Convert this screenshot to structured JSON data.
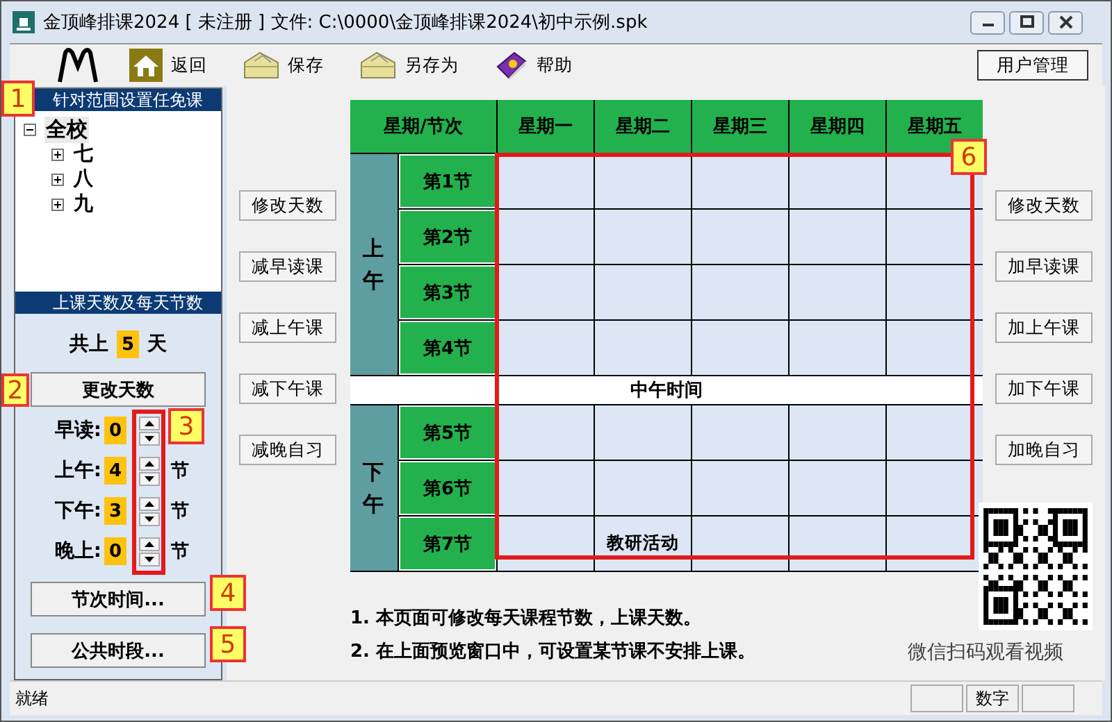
{
  "window": {
    "title": "金顶峰排课2024 [ 未注册 ] 文件: C:\\0000\\金顶峰排课2024\\初中示例.spk"
  },
  "toolbar": {
    "items": [
      {
        "kind": "home",
        "label": "返回"
      },
      {
        "kind": "folder",
        "label": "保存"
      },
      {
        "kind": "folder",
        "label": "另存为"
      },
      {
        "kind": "help",
        "label": "帮助"
      }
    ],
    "user_button": "用户管理"
  },
  "left_panel": {
    "scope_title": "针对范围设置任免课",
    "tree": {
      "label": "全校",
      "expanded": true,
      "selected": true,
      "children": [
        {
          "label": "七",
          "expanded": false,
          "selected": false
        },
        {
          "label": "八",
          "expanded": false,
          "selected": false
        },
        {
          "label": "九",
          "expanded": false,
          "selected": false
        }
      ]
    },
    "days_title": "上课天数及每天节数",
    "days": {
      "prefix": "共上",
      "value": "5",
      "suffix": "天"
    },
    "change_days_button": "更改天数",
    "periods": [
      {
        "label": "早读:",
        "value": "0"
      },
      {
        "label": "上午:",
        "value": "4",
        "unit": "节"
      },
      {
        "label": "下午:",
        "value": "3",
        "unit": "节"
      },
      {
        "label": "晚上:",
        "value": "0",
        "unit": "节"
      }
    ],
    "buttons": [
      "节次时间...",
      "公共时段..."
    ]
  },
  "left_buttons": [
    "修改天数",
    "减早读课",
    "减上午课",
    "减下午课",
    "减晚自习"
  ],
  "right_buttons": [
    "修改天数",
    "加早读课",
    "加上午课",
    "加下午课",
    "加晚自习"
  ],
  "timetable": {
    "corner": "星期/节次",
    "days": [
      "星期一",
      "星期二",
      "星期三",
      "星期四",
      "星期五"
    ],
    "sessions": [
      {
        "label": "上午",
        "periods": [
          {
            "label": "第1节",
            "cells": [
              {},
              {},
              {},
              {},
              {}
            ]
          },
          {
            "label": "第2节",
            "cells": [
              {},
              {},
              {},
              {},
              {}
            ]
          },
          {
            "label": "第3节",
            "cells": [
              {},
              {},
              {},
              {},
              {}
            ]
          },
          {
            "label": "第4节",
            "cells": [
              {},
              {},
              {},
              {},
              {}
            ]
          }
        ]
      },
      {
        "label": "下午",
        "periods": [
          {
            "label": "第5节",
            "cells": [
              {},
              {},
              {},
              {},
              {}
            ]
          },
          {
            "label": "第6节",
            "cells": [
              {},
              {},
              {},
              {},
              {}
            ]
          },
          {
            "label": "第7节",
            "cells": [
              {},
              {
                "text": "教研活动"
              },
              {},
              {},
              {}
            ]
          }
        ]
      }
    ],
    "break": "中午时间"
  },
  "notes": [
    "1. 本页面可修改每天课程节数，上课天数。",
    "2. 在上面预览窗口中，可设置某节课不安排上课。"
  ],
  "qr_caption": "微信扫码观看视频",
  "callouts": [
    "1",
    "2",
    "3",
    "4",
    "5",
    "6"
  ],
  "status_bar": {
    "text": "就绪",
    "panels": [
      {
        "kind": "blank"
      },
      {
        "kind": "label",
        "label": "数字"
      },
      {
        "kind": "blank"
      }
    ]
  }
}
